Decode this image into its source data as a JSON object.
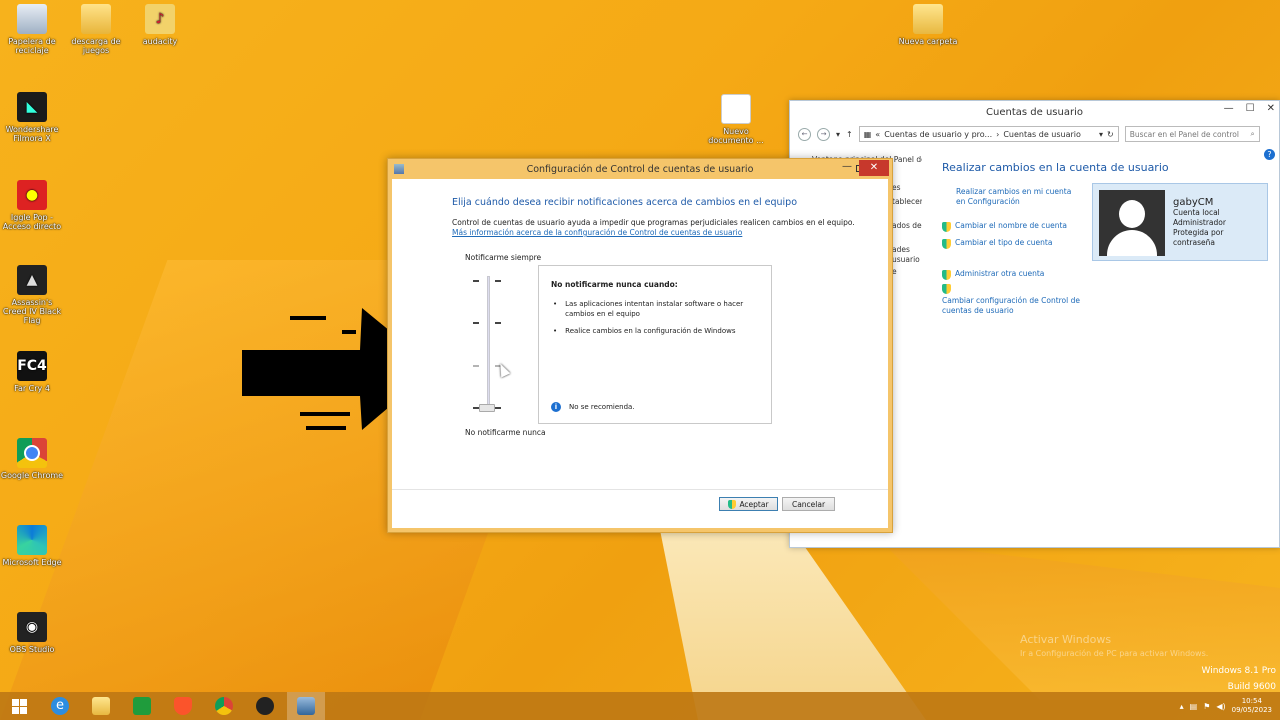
{
  "desktop_icons": [
    {
      "label": "Papelera de reciclaje"
    },
    {
      "label": "descarga de juegos"
    },
    {
      "label": "audacity"
    },
    {
      "label": "Nueva carpeta"
    },
    {
      "label": "Wondershare Filmora X"
    },
    {
      "label": "Nuevo documento ..."
    },
    {
      "label": "Iggle Pop - Acceso directo"
    },
    {
      "label": "Assassin's Creed IV Black Flag"
    },
    {
      "label": "Far Cry 4"
    },
    {
      "label": "Google Chrome"
    },
    {
      "label": "Microsoft Edge"
    },
    {
      "label": "OBS Studio"
    }
  ],
  "control_panel": {
    "title": "Cuentas de usuario",
    "address_prefix": "«",
    "address_crumb1": "Cuentas de usuario y pro...",
    "address_sep": "›",
    "address_crumb2": "Cuentas de usuario",
    "search_placeholder": "Buscar en el Panel de control",
    "left_items": [
      "Ventana principal del Panel de",
      "es",
      "tablecer",
      "ados de",
      "ades usuario",
      "e"
    ],
    "heading": "Realizar cambios en la cuenta de usuario",
    "links": [
      "Realizar cambios en mi cuenta en Configuración",
      "Cambiar el nombre de cuenta",
      "Cambiar el tipo de cuenta",
      "Administrar otra cuenta",
      "Cambiar configuración de Control de cuentas de usuario"
    ],
    "user": {
      "name": "gabyCM",
      "line1": "Cuenta local",
      "line2": "Administrador",
      "line3": "Protegida por contraseña"
    },
    "help": "?"
  },
  "uac_dialog": {
    "title": "Configuración de Control de cuentas de usuario",
    "close": "✕",
    "minimize": "—",
    "heading": "Elija cuándo desea recibir notificaciones acerca de cambios en el equipo",
    "description": "Control de cuentas de usuario ayuda a impedir que programas perjudiciales realicen cambios en el equipo.",
    "link": "Más información acerca de la configuración de Control de cuentas de usuario",
    "label_top": "Notificarme siempre",
    "label_bottom": "No notificarme nunca",
    "slider_level": 0,
    "slider_levels": 4,
    "info_title": "No notificarme nunca cuando:",
    "info_items": [
      "Las aplicaciones intentan instalar software o hacer cambios en el equipo",
      "Realice cambios en la configuración de Windows"
    ],
    "info_note": "No se recomienda.",
    "ok_label": "Aceptar",
    "cancel_label": "Cancelar"
  },
  "watermark": {
    "line1": "Activar Windows",
    "line2": "Ir a Configuración de PC para activar Windows.",
    "version1": "Windows 8.1 Pro",
    "version2": "Build 9600"
  },
  "taskbar": {
    "items": [
      "start",
      "internet-explorer",
      "file-explorer",
      "store",
      "brave",
      "chrome",
      "obs",
      "control-panel"
    ],
    "time": "10:54",
    "date": "09/05/2023"
  },
  "colors": {
    "desktop": "#f5a915",
    "link": "#1e6ab8",
    "heading": "#1e5aa8",
    "dialog_border": "#f5c56a"
  }
}
